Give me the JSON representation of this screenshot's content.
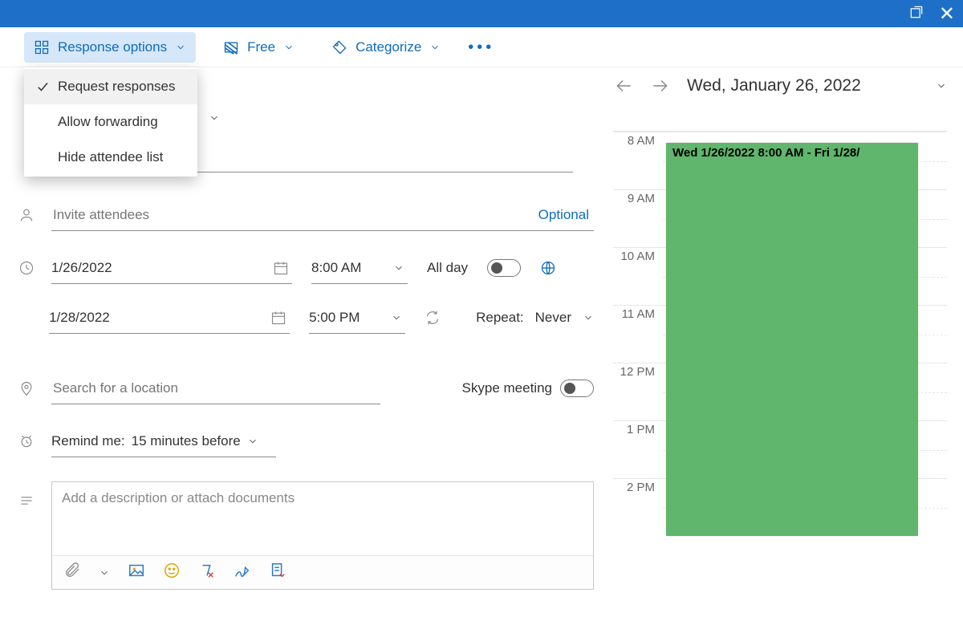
{
  "titlebar": {},
  "ribbon": {
    "response_options": "Response options",
    "free": "Free",
    "categorize": "Categorize"
  },
  "response_menu": {
    "item1": "Request responses",
    "item2": "Allow forwarding",
    "item3": "Hide attendee list"
  },
  "form": {
    "attendees_placeholder": "Invite attendees",
    "optional": "Optional",
    "start_date": "1/26/2022",
    "start_time": "8:00 AM",
    "end_date": "1/28/2022",
    "end_time": "5:00 PM",
    "all_day": "All day",
    "repeat_label": "Repeat:",
    "repeat_value": "Never",
    "location_placeholder": "Search for a location",
    "skype": "Skype meeting",
    "reminder_label": "Remind me:",
    "reminder_value": "15 minutes before",
    "description_placeholder": "Add a description or attach documents"
  },
  "calendar": {
    "date": "Wed, January 26, 2022",
    "event_text": "Wed 1/26/2022 8:00 AM - Fri 1/28/",
    "hours": {
      "h8": "8 AM",
      "h9": "9 AM",
      "h10": "10 AM",
      "h11": "11 AM",
      "h12": "12 PM",
      "h13": "1 PM",
      "h14": "2 PM"
    }
  }
}
